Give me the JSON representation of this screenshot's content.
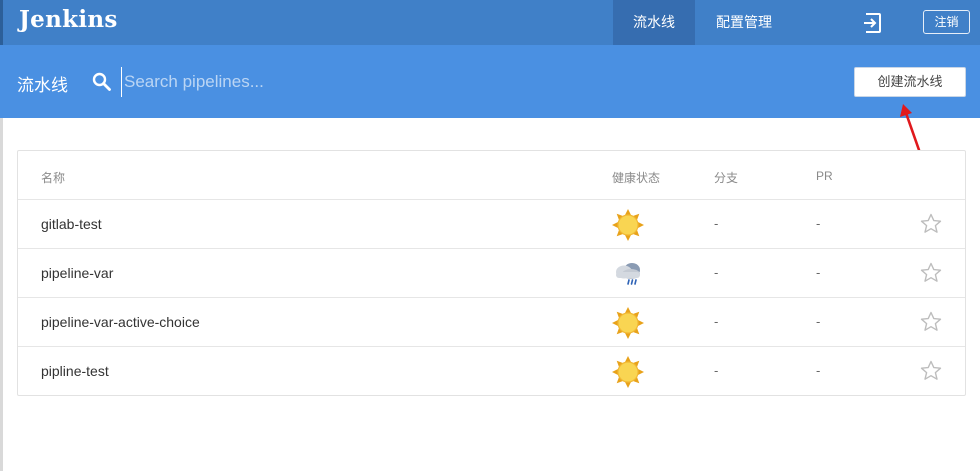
{
  "topbar": {
    "logo": "Jenkins",
    "tabs": [
      {
        "label": "流水线",
        "active": true
      },
      {
        "label": "配置管理",
        "active": false
      }
    ],
    "logout_icon": "logout-icon",
    "logout_label": "注销"
  },
  "subbar": {
    "title": "流水线",
    "search_icon": "search-icon",
    "search_placeholder": "Search pipelines...",
    "create_label": "创建流水线"
  },
  "table": {
    "columns": {
      "name": "名称",
      "health": "健康状态",
      "branch": "分支",
      "pr": "PR"
    },
    "rows": [
      {
        "name": "gitlab-test",
        "health": "sunny-icon",
        "branch": "-",
        "pr": "-",
        "favorite": false
      },
      {
        "name": "pipeline-var",
        "health": "rain-cloud-icon",
        "branch": "-",
        "pr": "-",
        "favorite": false
      },
      {
        "name": "pipeline-var-active-choice",
        "health": "sunny-icon",
        "branch": "-",
        "pr": "-",
        "favorite": false
      },
      {
        "name": "pipline-test",
        "health": "sunny-icon",
        "branch": "-",
        "pr": "-",
        "favorite": false
      }
    ]
  },
  "colors": {
    "topbar": "#4080c8",
    "subbar": "#4a90e2",
    "active_tab": "#366db0",
    "annotation_arrow": "#e0191d"
  }
}
